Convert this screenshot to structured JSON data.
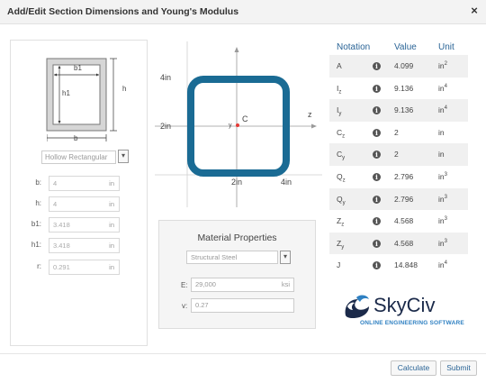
{
  "dialog": {
    "title": "Add/Edit Section Dimensions and Young's Modulus",
    "close_label": "×"
  },
  "section": {
    "thumb_labels": {
      "b1": "b1",
      "h1": "h1",
      "h": "h",
      "b": "b"
    },
    "shape_select": "Hollow Rectangular",
    "shape_arrow": "▾",
    "dimensions": [
      {
        "label": "b:",
        "value": "4",
        "unit": "in"
      },
      {
        "label": "h:",
        "value": "4",
        "unit": "in"
      },
      {
        "label": "b1:",
        "value": "3.418",
        "unit": "in"
      },
      {
        "label": "h1:",
        "value": "3.418",
        "unit": "in"
      },
      {
        "label": "r:",
        "value": "0.291",
        "unit": "in"
      }
    ]
  },
  "diagram": {
    "y_top": "4in",
    "y_mid": "2in",
    "x_mid": "2in",
    "x_right": "4in",
    "z_axis": "z",
    "y_axis": "y",
    "centroid": "C",
    "shape_color": "#1a6b94",
    "centroid_color": "#e53935"
  },
  "material": {
    "title": "Material Properties",
    "select": "Structural Steel",
    "select_arrow": "▾",
    "e_label": "E:",
    "e_value": "29,000",
    "e_unit": "ksi",
    "v_label": "v:",
    "v_value": "0.27"
  },
  "table": {
    "headers": {
      "notation": "Notation",
      "value": "Value",
      "unit": "Unit"
    },
    "info_icon": "i",
    "rows": [
      {
        "notation": "A",
        "sub": "",
        "value": "4.099",
        "unit": "in",
        "power": "2"
      },
      {
        "notation": "I",
        "sub": "z",
        "value": "9.136",
        "unit": "in",
        "power": "4"
      },
      {
        "notation": "I",
        "sub": "y",
        "value": "9.136",
        "unit": "in",
        "power": "4"
      },
      {
        "notation": "C",
        "sub": "z",
        "value": "2",
        "unit": "in",
        "power": ""
      },
      {
        "notation": "C",
        "sub": "y",
        "value": "2",
        "unit": "in",
        "power": ""
      },
      {
        "notation": "Q",
        "sub": "z",
        "value": "2.796",
        "unit": "in",
        "power": "3"
      },
      {
        "notation": "Q",
        "sub": "y",
        "value": "2.796",
        "unit": "in",
        "power": "3"
      },
      {
        "notation": "Z",
        "sub": "z",
        "value": "4.568",
        "unit": "in",
        "power": "3"
      },
      {
        "notation": "Z",
        "sub": "y",
        "value": "4.568",
        "unit": "in",
        "power": "3"
      },
      {
        "notation": "J",
        "sub": "",
        "value": "14.848",
        "unit": "in",
        "power": "4"
      }
    ]
  },
  "logo": {
    "name": "SkyCiv",
    "tagline": "ONLINE ENGINEERING SOFTWARE"
  },
  "footer": {
    "calculate": "Calculate",
    "submit": "Submit"
  }
}
